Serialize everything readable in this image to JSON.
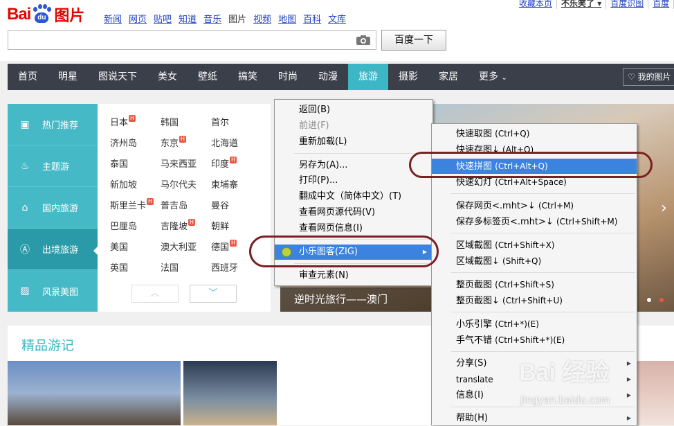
{
  "logo": {
    "bai": "Bai",
    "du": "du",
    "tu": "图片"
  },
  "topnav": [
    "新闻",
    "网页",
    "贴吧",
    "知道",
    "音乐",
    "图片",
    "视频",
    "地图",
    "百科",
    "文库"
  ],
  "toplinks": {
    "favorite": "收藏本页",
    "user": "不乐笑了",
    "baidu_id": "百度识图",
    "more": "百度"
  },
  "search": {
    "value": "",
    "button": "百度一下"
  },
  "navbar": [
    "首页",
    "明星",
    "图说天下",
    "美女",
    "壁纸",
    "搞笑",
    "时尚",
    "动漫",
    "旅游",
    "摄影",
    "家居",
    "更多"
  ],
  "navbar_active": "旅游",
  "my_pictures": "我的图片",
  "categories": [
    {
      "label": "热门推荐",
      "icon": "bag-icon"
    },
    {
      "label": "主题游",
      "icon": "flame-icon"
    },
    {
      "label": "国内旅游",
      "icon": "pagoda-icon"
    },
    {
      "label": "出境旅游",
      "icon": "tower-icon"
    },
    {
      "label": "风景美图",
      "icon": "picture-icon"
    }
  ],
  "places": [
    [
      "日本",
      "韩国",
      "首尔"
    ],
    [
      "济州岛",
      "东京",
      "北海道"
    ],
    [
      "泰国",
      "马来西亚",
      "印度"
    ],
    [
      "新加坡",
      "马尔代夫",
      "柬埔寨"
    ],
    [
      "斯里兰卡",
      "普吉岛",
      "曼谷"
    ],
    [
      "巴厘岛",
      "吉隆坡",
      "朝鲜"
    ],
    [
      "美国",
      "澳大利亚",
      "德国"
    ],
    [
      "英国",
      "法国",
      "西班牙"
    ]
  ],
  "banner_caption": "逆时光旅行——澳门",
  "section_title": "精品游记",
  "context_menu": {
    "back": "返回(B)",
    "forward": "前进(F)",
    "reload": "重新加载(L)",
    "save_as": "另存为(A)...",
    "print": "打印(P)...",
    "translate": "翻成中文（简体中文）(T)",
    "view_source": "查看网页源代码(V)",
    "view_info": "查看网页信息(I)",
    "plugin": "小乐图客(ZIG)",
    "inspect": "审查元素(N)"
  },
  "submenu": {
    "quick_grab": {
      "label": "快速取图",
      "shortcut": "(Ctrl+Q)"
    },
    "quick_save": {
      "label": "快速存图↓",
      "shortcut": "(Alt+Q)"
    },
    "quick_stitch": {
      "label": "快速拼图",
      "shortcut": "(Ctrl+Alt+Q)"
    },
    "quick_slide": {
      "label": "快速幻灯",
      "shortcut": "(Ctrl+Alt+Space)"
    },
    "save_page": {
      "label": "保存网页<.mht>↓",
      "shortcut": "(Ctrl+M)"
    },
    "save_tabs": {
      "label": "保存多标签页<.mht>↓",
      "shortcut": "(Ctrl+Shift+M)"
    },
    "region_shot": {
      "label": "区域截图",
      "shortcut": "(Ctrl+Shift+X)"
    },
    "region_shot_save": {
      "label": "区域截图↓",
      "shortcut": "(Shift+Q)"
    },
    "full_shot": {
      "label": "整页截图",
      "shortcut": "(Ctrl+Shift+S)"
    },
    "full_shot_save": {
      "label": "整页截图↓",
      "shortcut": "(Ctrl+Shift+U)"
    },
    "engine": {
      "label": "小乐引擎",
      "shortcut": "(Ctrl+*)(E)"
    },
    "lucky": {
      "label": "手气不错",
      "shortcut": "(Ctrl+Shift+*)(E)"
    },
    "share": "分享(S)",
    "translate": "translate",
    "info": "信息(I)",
    "help": "帮助(H)"
  },
  "watermark": {
    "main": "Bai 经验",
    "url": "jingyan.baidu.com"
  }
}
